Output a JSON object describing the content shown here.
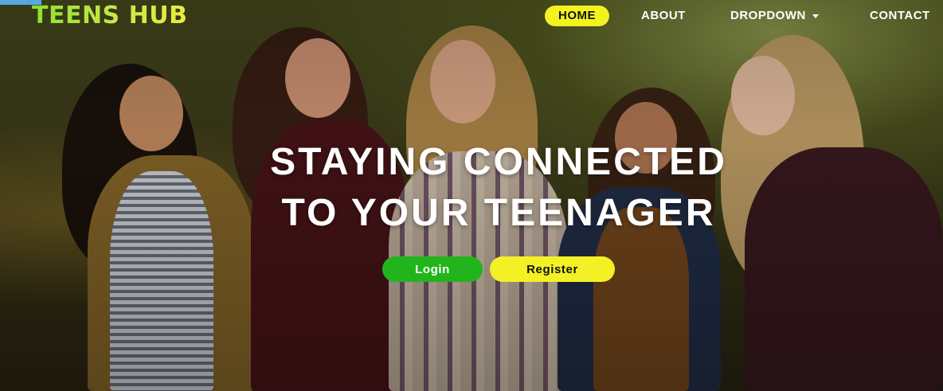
{
  "brand": {
    "name": "TEENS HUB"
  },
  "nav": {
    "items": [
      {
        "label": "HOME",
        "active": true
      },
      {
        "label": "ABOUT",
        "active": false
      },
      {
        "label": "DROPDOWN",
        "active": false,
        "has_caret": true
      },
      {
        "label": "CONTACT",
        "active": false
      }
    ]
  },
  "hero": {
    "headline_line1": "STAYING CONNECTED",
    "headline_line2": "TO YOUR TEENAGER",
    "login_label": "Login",
    "register_label": "Register"
  },
  "colors": {
    "accent_yellow": "#f2f21f",
    "login_green": "#22b41d",
    "brand_gradient_start": "#8be02e",
    "brand_gradient_end": "#ecec3c"
  },
  "icons": [
    "caret-down-icon"
  ]
}
